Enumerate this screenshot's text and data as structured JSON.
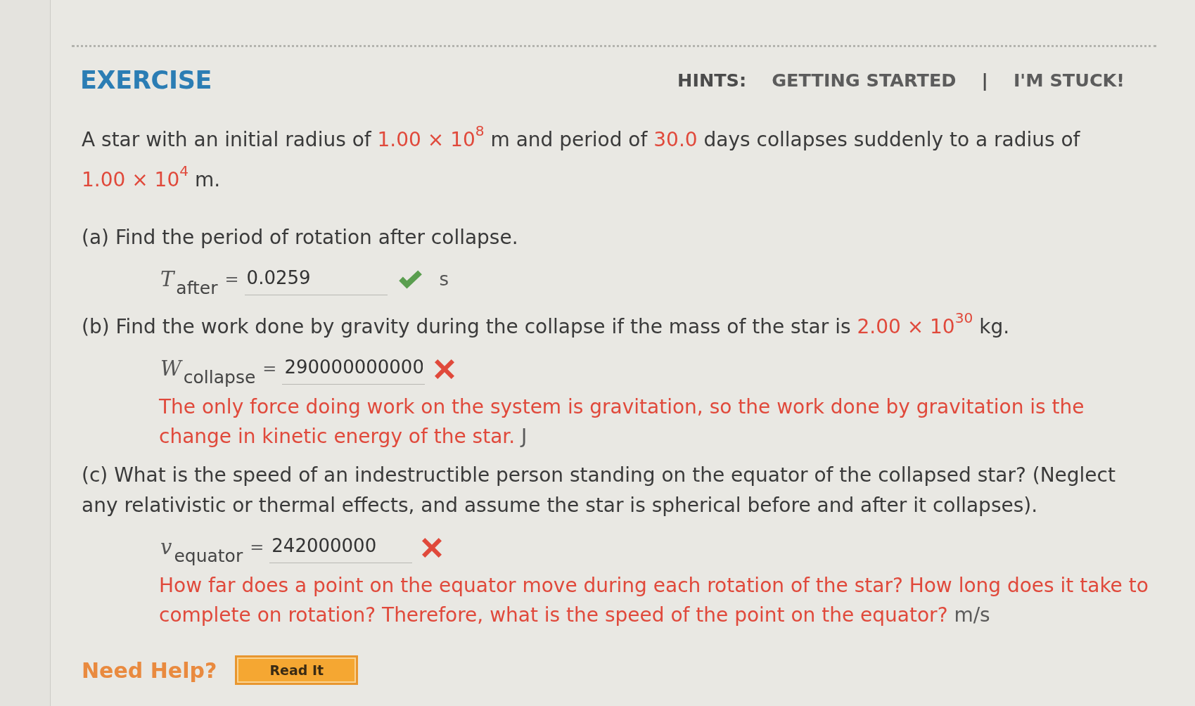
{
  "header": {
    "title": "EXERCISE",
    "hints_label": "HINTS:",
    "hints": [
      {
        "label": "GETTING STARTED"
      },
      {
        "label": "I'M STUCK!"
      }
    ],
    "separator": "|"
  },
  "problem": [
    {
      "kind": "text",
      "text": "A star with an initial radius of "
    },
    {
      "kind": "given",
      "text": "1.00 × 10$^{8}$"
    },
    {
      "kind": "text",
      "text": " m and period of "
    },
    {
      "kind": "given",
      "text": "30.0"
    },
    {
      "kind": "text",
      "text": " days collapses suddenly to a radius of "
    },
    {
      "kind": "given",
      "text": "1.00 × 10$^{4}$"
    },
    {
      "kind": "text",
      "text": " m."
    }
  ],
  "parts": [
    {
      "question": [
        {
          "kind": "text",
          "text": "(a) Find the period of rotation after collapse."
        }
      ],
      "answer": {
        "symbol": "T",
        "subscript": "after",
        "equals": "=",
        "value": "0.0259",
        "correct": true,
        "unit": "s"
      }
    },
    {
      "question": [
        {
          "kind": "text",
          "text": "(b) Find the work done by gravity during the collapse if the mass of the star is "
        },
        {
          "kind": "given",
          "text": "2.00 × 10$^{30}$"
        },
        {
          "kind": "text",
          "text": " kg."
        }
      ],
      "answer": {
        "symbol": "W",
        "subscript": "collapse",
        "equals": "=",
        "value": "290000000000",
        "correct": false
      },
      "feedback": {
        "text": "The only force doing work on the system is gravitation, so the work done by gravitation is the change in kinetic energy of the star.",
        "unit": "J"
      }
    },
    {
      "question": [
        {
          "kind": "text",
          "text": "(c) What is the speed of an indestructible person standing on the equator of the collapsed star? (Neglect any relativistic or thermal effects, and assume the star is spherical before and after it collapses)."
        }
      ],
      "answer": {
        "symbol": "v",
        "subscript": "equator",
        "equals": "=",
        "value": "242000000",
        "correct": false
      },
      "feedback": {
        "text": "How far does a point on the equator move during each rotation of the star? How long does it take to complete on rotation? Therefore, what is the speed of the point on the equator?",
        "unit": "m/s"
      }
    }
  ],
  "help": {
    "label": "Need Help?",
    "buttons": [
      "Read It"
    ]
  }
}
